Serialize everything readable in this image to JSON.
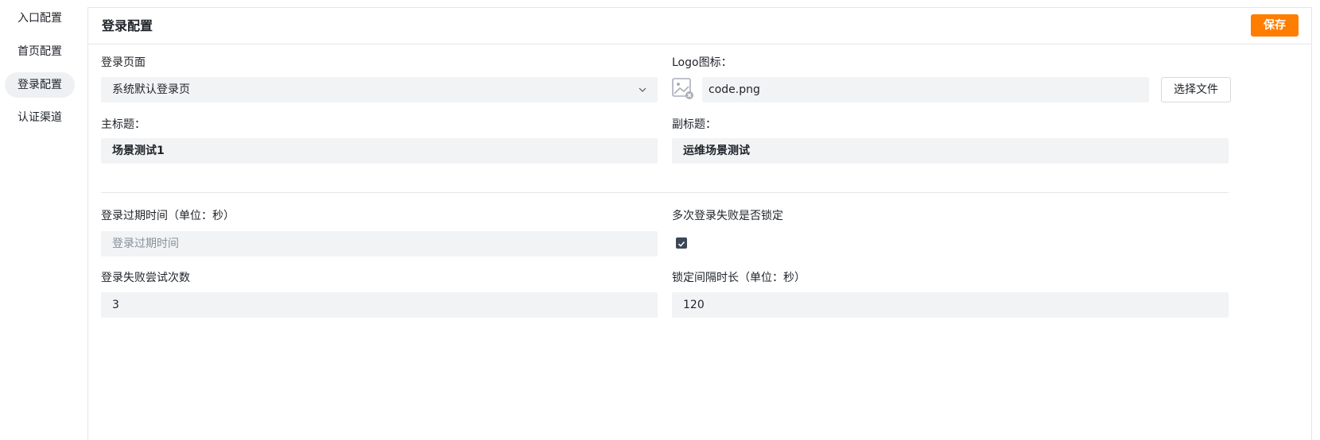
{
  "sidebar": {
    "items": [
      {
        "label": "入口配置"
      },
      {
        "label": "首页配置"
      },
      {
        "label": "登录配置",
        "active": true
      },
      {
        "label": "认证渠道"
      }
    ]
  },
  "panel": {
    "title": "登录配置",
    "save_label": "保存"
  },
  "form": {
    "login_page": {
      "label": "登录页面",
      "value": "系统默认登录页",
      "icon": "chevron-down-icon"
    },
    "logo": {
      "label": "Logo图标：",
      "value": "code.png",
      "button_label": "选择文件",
      "icon": "image-placeholder-icon"
    },
    "main_title": {
      "label": "主标题：",
      "value": "场景测试1"
    },
    "sub_title": {
      "label": "副标题：",
      "value": "运维场景测试"
    },
    "expire_time": {
      "label": "登录过期时间（单位：秒）",
      "value": "",
      "placeholder": "登录过期时间"
    },
    "lock_on_fail": {
      "label": "多次登录失败是否锁定",
      "checked": true
    },
    "fail_attempts": {
      "label": "登录失败尝试次数",
      "value": "3"
    },
    "lock_interval": {
      "label": "锁定间隔时长（单位：秒）",
      "value": "120"
    }
  },
  "colors": {
    "accent": "#ff7d00",
    "field_bg": "#f2f3f5",
    "checkbox": "#3c4757"
  }
}
